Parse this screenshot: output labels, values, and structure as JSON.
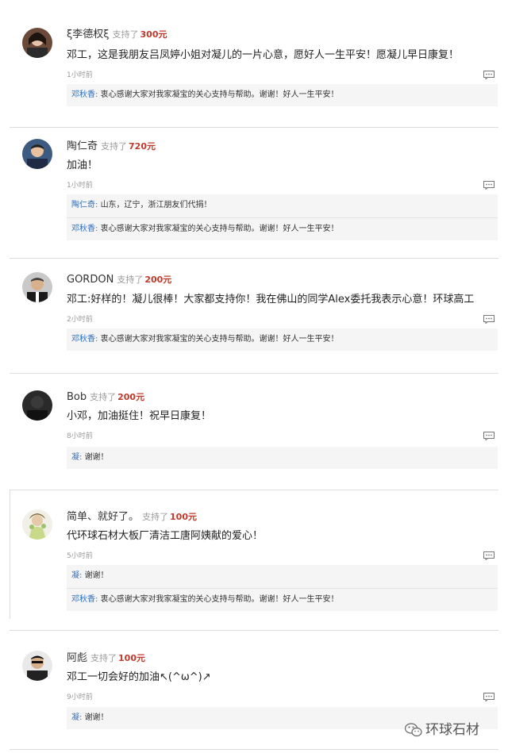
{
  "comments": [
    {
      "name": "李德权",
      "name_prefix": "ξ",
      "name_suffix": "ξ",
      "support_label": "支持了",
      "amount": "300元",
      "text": "邓工，这是我朋友吕凤婷小姐对凝儿的一片心意，愿好人一生平安！愿凝儿早日康复！",
      "time": "1小时前",
      "replies": [
        {
          "name": "邓秋香:",
          "text": "衷心感谢大家对我家凝宝的关心支持与帮助。谢谢！好人一生平安！"
        }
      ]
    },
    {
      "name": "陶仁奇",
      "support_label": "支持了",
      "amount": "720元",
      "text": "加油！",
      "time": "1小时前",
      "replies": [
        {
          "name": "陶仁奇:",
          "text": "山东，辽宁，浙江朋友们代捐！"
        },
        {
          "name": "邓秋香:",
          "text": "衷心感谢大家对我家凝宝的关心支持与帮助。谢谢！好人一生平安！"
        }
      ]
    },
    {
      "name": "GORDON",
      "support_label": "支持了",
      "amount": "200元",
      "text": "邓工:好样的！凝儿很棒！大家都支持你！我在佛山的同学Alex委托我表示心意！环球高工",
      "time": "2小时前",
      "replies": [
        {
          "name": "邓秋香:",
          "text": "衷心感谢大家对我家凝宝的关心支持与帮助。谢谢！好人一生平安！"
        }
      ]
    },
    {
      "name": "Bob",
      "support_label": "支持了",
      "amount": "200元",
      "text": "小邓，加油挺住！祝早日康复！",
      "time": "8小时前",
      "replies": [
        {
          "name": "凝:",
          "text": "谢谢！"
        }
      ]
    },
    {
      "name": "简单、就好了。",
      "support_label": "支持了",
      "amount": "100元",
      "text": "代环球石材大板厂清洁工唐阿姨献的爱心！",
      "time": "5小时前",
      "replies": [
        {
          "name": "凝:",
          "text": "谢谢！"
        },
        {
          "name": "邓秋香:",
          "text": "衷心感谢大家对我家凝宝的关心支持与帮助。谢谢！好人一生平安！"
        }
      ]
    },
    {
      "name": "阿彪",
      "support_label": "支持了",
      "amount": "100元",
      "text": "邓工一切会好的加油↖(^ω^)↗",
      "time": "9小时前",
      "replies": [
        {
          "name": "凝:",
          "text": "谢谢！"
        }
      ]
    }
  ],
  "watermark": "环球石材",
  "icons": {
    "reply": "comment-bubble-icon",
    "watermark": "wechat-logo-icon"
  },
  "colors": {
    "amount": "#c0392b",
    "reply_name": "#2f6fbd",
    "reply_bg": "#f5f5f5"
  }
}
